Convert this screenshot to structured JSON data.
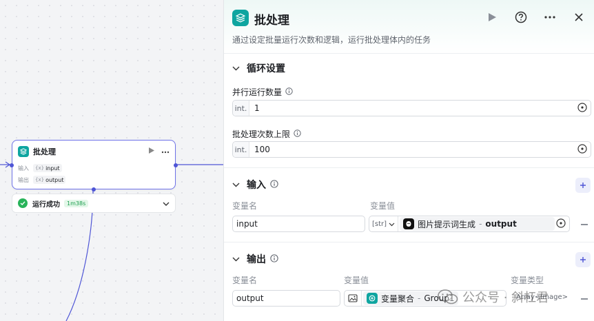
{
  "node": {
    "title": "批处理",
    "input_label": "输入",
    "output_label": "输出",
    "input_type": "{x}",
    "input_name": "input",
    "output_type": "{x}",
    "output_name": "output",
    "status_text": "运行成功",
    "duration": "1m38s"
  },
  "panel": {
    "title": "批处理",
    "description": "通过设定批量运行次数和逻辑，运行批处理体内的任务",
    "loop": {
      "title": "循环设置",
      "parallel_label": "并行运行数量",
      "parallel_type": "int.",
      "parallel_value": "1",
      "limit_label": "批处理次数上限",
      "limit_type": "int.",
      "limit_value": "100"
    },
    "input": {
      "title": "输入",
      "col_name": "变量名",
      "col_value": "变量值",
      "row_name": "input",
      "row_type": "[str]",
      "ref_node": "图片提示词生成",
      "ref_sep": "-",
      "ref_var": "output"
    },
    "output": {
      "title": "输出",
      "col_name": "变量名",
      "col_value": "变量值",
      "col_type": "变量类型",
      "row_name": "output",
      "ref_node": "变量聚合",
      "ref_sep": "-",
      "ref_var": "Group1",
      "row_type_value": "Array<Image>"
    }
  },
  "watermark": {
    "text": "公众号 · 斜杠君"
  },
  "colors": {
    "accent": "#4e55d6",
    "teal": "#0fa5a0",
    "success": "#28b35a"
  }
}
